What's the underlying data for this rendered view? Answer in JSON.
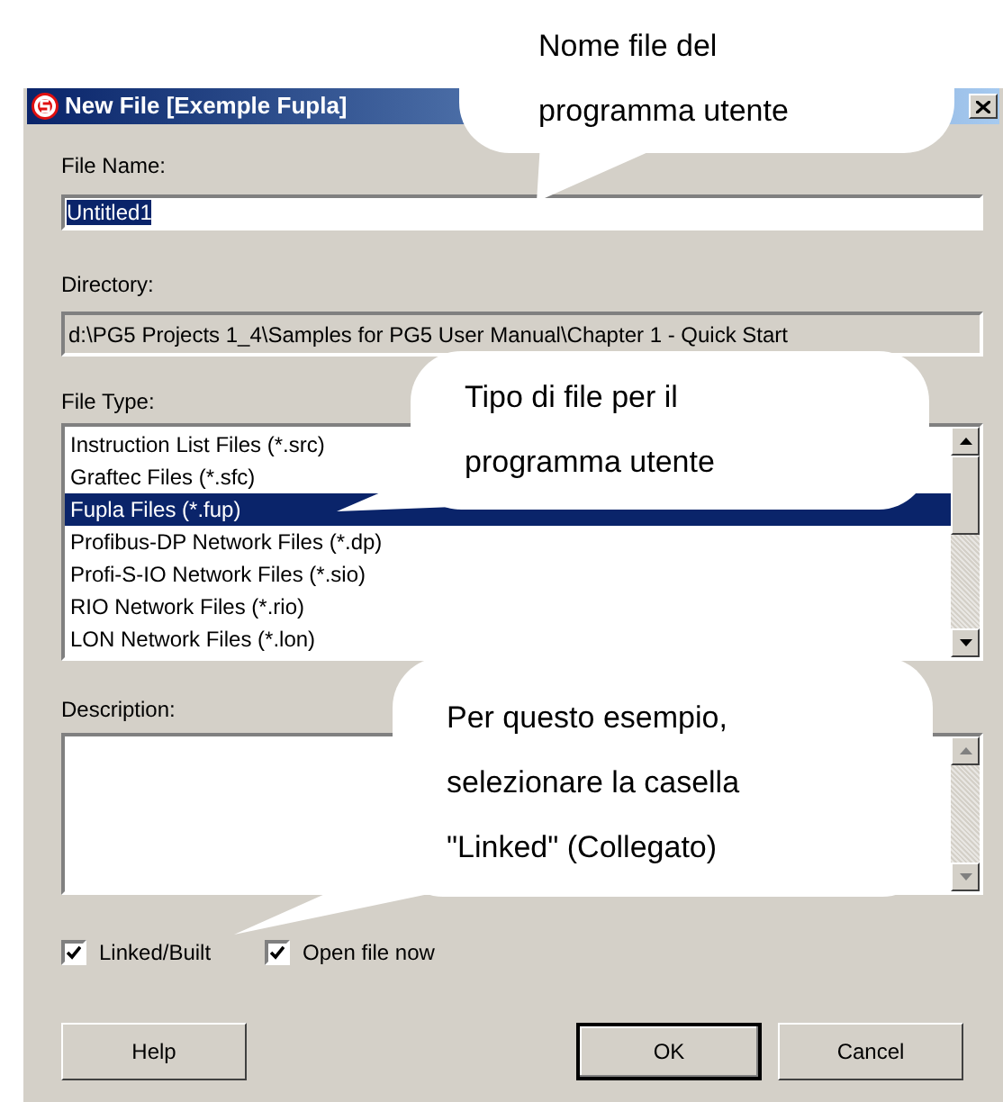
{
  "window": {
    "title": "New File [Exemple Fupla]"
  },
  "file_name": {
    "label": "File Name:",
    "value": "Untitled1"
  },
  "directory": {
    "label": "Directory:",
    "value": "d:\\PG5 Projects 1_4\\Samples for PG5 User Manual\\Chapter 1 - Quick Start"
  },
  "file_type": {
    "label": "File Type:",
    "items": [
      {
        "label": "Instruction List Files (*.src)",
        "selected": false
      },
      {
        "label": "Graftec Files (*.sfc)",
        "selected": false
      },
      {
        "label": "Fupla Files (*.fup)",
        "selected": true
      },
      {
        "label": "Profibus-DP Network Files (*.dp)",
        "selected": false
      },
      {
        "label": "Profi-S-IO Network Files (*.sio)",
        "selected": false
      },
      {
        "label": "RIO Network Files (*.rio)",
        "selected": false
      },
      {
        "label": "LON Network Files (*.lon)",
        "selected": false
      }
    ]
  },
  "description": {
    "label": "Description:"
  },
  "options": [
    {
      "label": "Linked/Built",
      "checked": true
    },
    {
      "label": "Open file now",
      "checked": true
    }
  ],
  "buttons": [
    {
      "label": "Help",
      "default": false
    },
    {
      "label": "OK",
      "default": true
    },
    {
      "label": "Cancel",
      "default": false
    }
  ],
  "callouts": [
    {
      "lines": [
        "Nome file del",
        "programma utente"
      ]
    },
    {
      "lines": [
        "Tipo di file per il",
        "programma utente"
      ]
    },
    {
      "lines": [
        "Per questo esempio,",
        "selezionare la casella",
        "\"Linked\" (Collegato)"
      ]
    }
  ]
}
